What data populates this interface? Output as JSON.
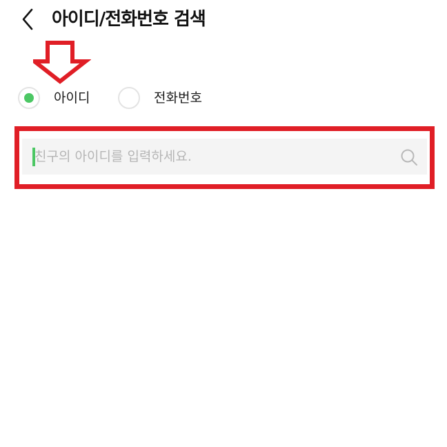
{
  "header": {
    "title": "아이디/전화번호 검색",
    "back_icon": "chevron-left-icon"
  },
  "search_type": {
    "selected": "id",
    "options": [
      {
        "key": "id",
        "label": "아이디",
        "selected": true
      },
      {
        "key": "phone",
        "label": "전화번호",
        "selected": false
      }
    ]
  },
  "search": {
    "placeholder": "친구의 아이디를 입력하세요.",
    "value": "",
    "icon": "search-icon"
  },
  "colors": {
    "accent": "#4cc764",
    "annotation": "#e01e26",
    "input_background": "#f4f4f4",
    "placeholder": "#b5b5b5"
  }
}
